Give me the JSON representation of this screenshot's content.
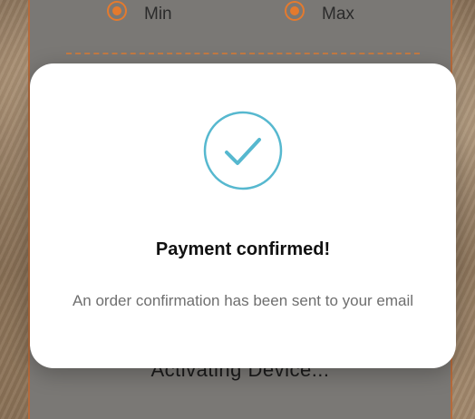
{
  "background_app": {
    "options": [
      {
        "label": "Min",
        "selected": true
      },
      {
        "label": "Max",
        "selected": true
      }
    ],
    "status_text": "Activating Device..."
  },
  "modal": {
    "icon": "checkmark-circle-icon",
    "title": "Payment confirmed!",
    "message": "An order confirmation has been sent to your email"
  },
  "colors": {
    "accent": "#56b8cf",
    "orange": "#e47a2e",
    "modal_bg": "#ffffff"
  }
}
